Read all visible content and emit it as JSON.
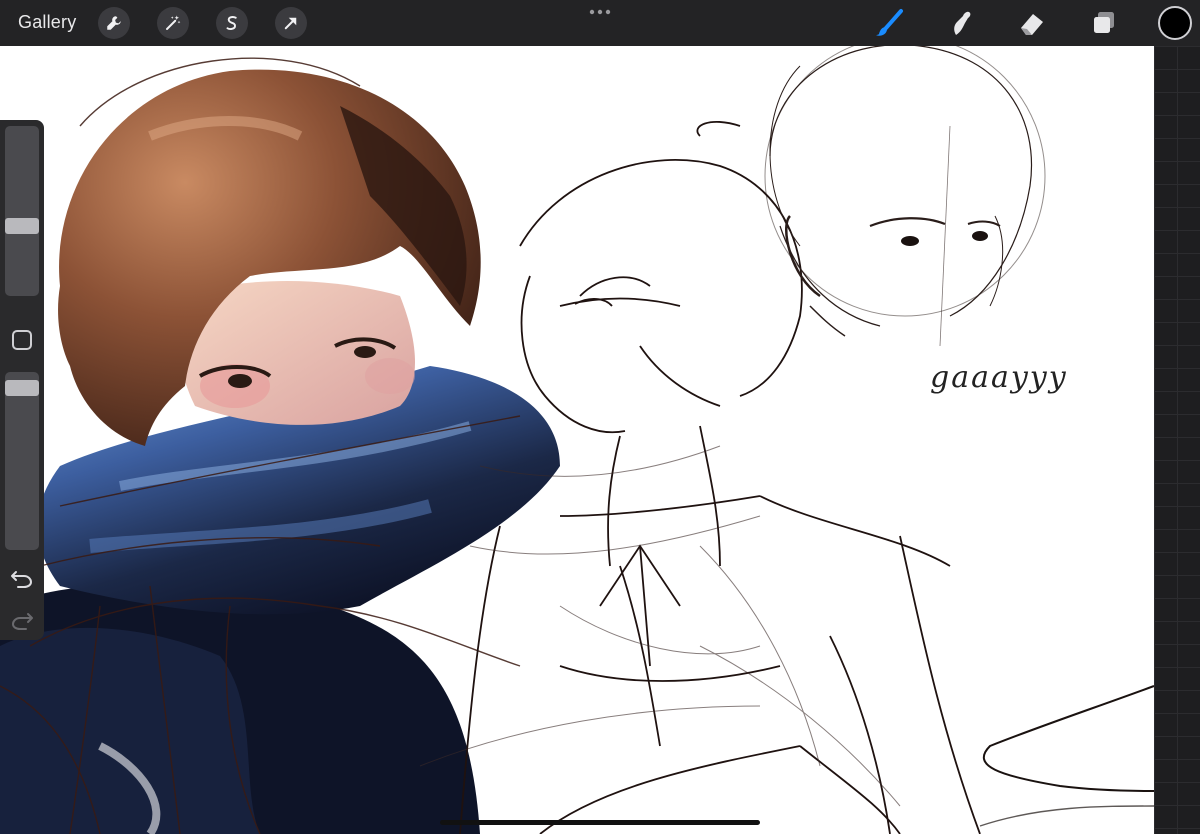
{
  "toolbar": {
    "gallery_label": "Gallery",
    "left_tools": [
      "wrench-icon",
      "magic-wand-icon",
      "selection-s-icon",
      "transform-arrow-icon"
    ],
    "right_tools": [
      "brush-icon",
      "smudge-icon",
      "eraser-icon",
      "layers-icon"
    ],
    "active_tool": "brush-icon",
    "accent_color": "#1a8cff",
    "current_color": "#000000"
  },
  "sidebar": {
    "brush_size_level": 0.4,
    "opacity_level": 0.95,
    "undo_icon": "undo-icon",
    "redo_icon": "redo-icon"
  },
  "canvas": {
    "handwriting_text": "gaaayyy"
  }
}
